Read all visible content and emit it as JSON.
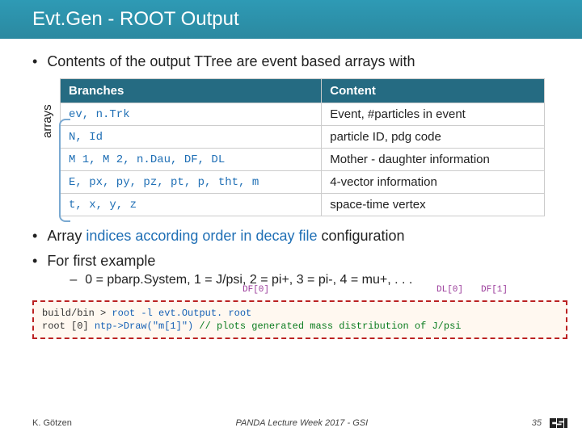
{
  "title": "Evt.Gen - ROOT Output",
  "bullet1": "Contents of the output TTree are event based arrays with",
  "table": {
    "h1": "Branches",
    "h2": "Content",
    "rows": [
      {
        "code": "ev, n.Trk",
        "desc": "Event, #particles in event"
      },
      {
        "code": "N, Id",
        "desc": "particle ID, pdg code"
      },
      {
        "code": "M 1, M 2, n.Dau, DF, DL",
        "desc": "Mother - daughter information"
      },
      {
        "code": "E, px, py, pz, pt, p, tht, m",
        "desc": "4-vector information"
      },
      {
        "code": "t, x, y, z",
        "desc": "space-time vertex"
      }
    ]
  },
  "arrays_label": "arrays",
  "bullet2_pre": "Array ",
  "bullet2_blue": "indices according order in decay file",
  "bullet2_post": " configuration",
  "bullet3": "For first example",
  "sub_pre": "0 = pbarp.System, 1 = J/psi, 2 = pi+, 3 = pi-, 4 = mu+, . . .",
  "ann": {
    "a0": "DF[0]",
    "a1": "DL[0]",
    "a2": "DF[1]"
  },
  "code": {
    "line1_prompt": "build/bin > ",
    "line1_cmd": "root -l evt.Output. root",
    "line2_prompt": "root [0] ",
    "line2_cmd": "ntp->Draw(\"m[1]\")",
    "line2_comment": " // plots generated mass distribution of J/psi"
  },
  "footer": {
    "left": "K. Götzen",
    "center": "PANDA Lecture Week 2017 - GSI",
    "page": "35",
    "logo": "GSI"
  }
}
